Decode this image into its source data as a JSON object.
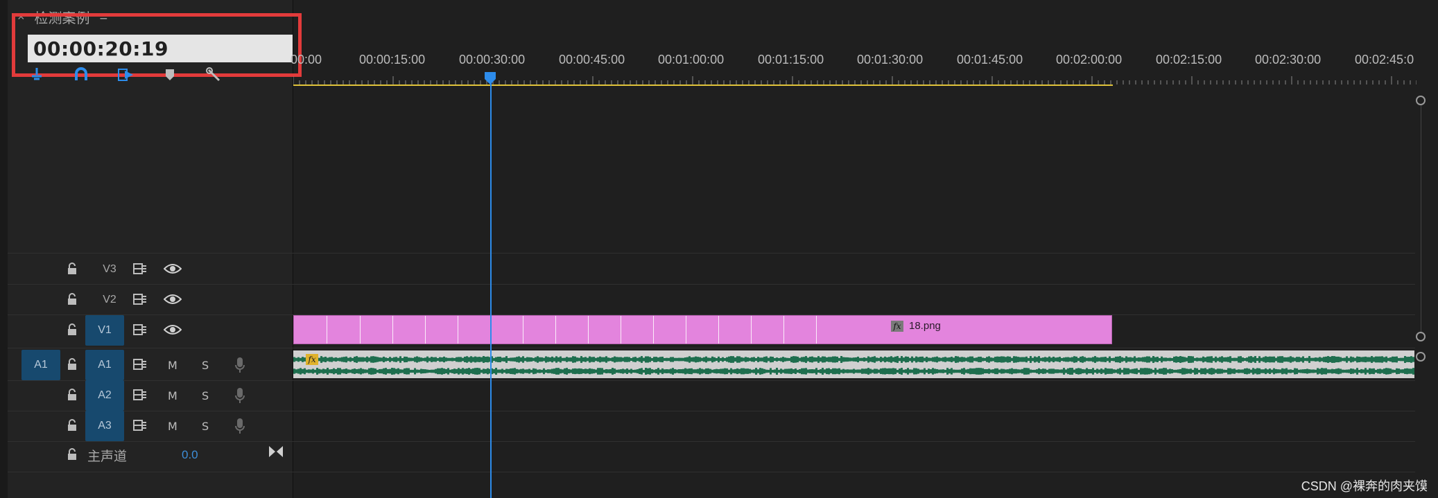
{
  "panel": {
    "close_glyph": "×",
    "title": "检测案例",
    "menu_glyph": "≡",
    "timecode": "00:00:20:19"
  },
  "tool_icons": [
    "snap-icon",
    "linked-selection-icon",
    "insert-marker-icon",
    "marker-icon",
    "wrench-icon"
  ],
  "ruler": {
    "labels": [
      "00:00",
      "00:00:15:00",
      "00:00:30:00",
      "00:00:45:00",
      "00:01:00:00",
      "00:01:15:00",
      "00:01:30:00",
      "00:01:45:00",
      "00:02:00:00",
      "00:02:15:00",
      "00:02:30:00",
      "00:02:45:0"
    ]
  },
  "tracks": {
    "v3": {
      "label": "V3"
    },
    "v2": {
      "label": "V2"
    },
    "v1": {
      "label": "V1"
    },
    "a1": {
      "source": "A1",
      "label": "A1",
      "mute": "M",
      "solo": "S"
    },
    "a2": {
      "label": "A2",
      "mute": "M",
      "solo": "S"
    },
    "a3": {
      "label": "A3",
      "mute": "M",
      "solo": "S"
    },
    "master": {
      "label": "主声道",
      "value": "0.0"
    }
  },
  "clips": {
    "v1_name": "18.png",
    "fx_label": "fx"
  },
  "watermark": "CSDN @裸奔的肉夹馍",
  "colors": {
    "background": "#1f1f1f",
    "video_clip": "#e384dd",
    "audio_waveform": "#1e6e4e",
    "playhead": "#2d8ceb",
    "track_active": "#17496e",
    "highlight": "#e23b3b",
    "work_area": "#e0c33a"
  }
}
